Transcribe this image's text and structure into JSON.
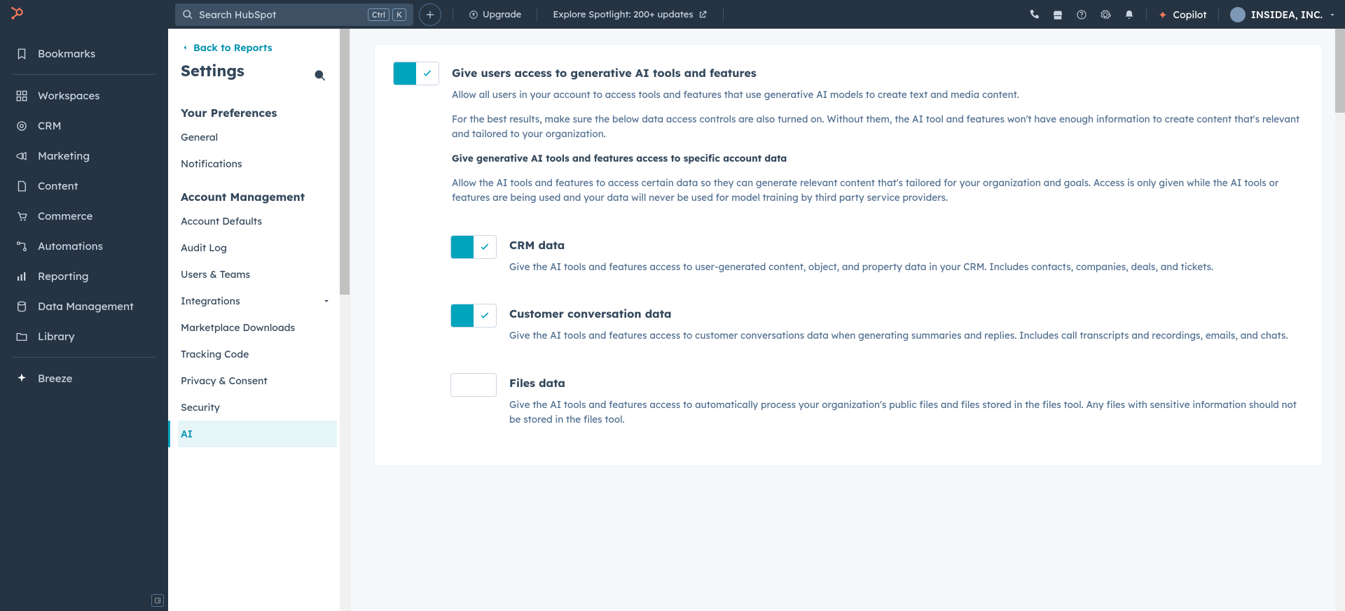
{
  "topbar": {
    "search_placeholder": "Search HubSpot",
    "kbd": [
      "Ctrl",
      "K"
    ],
    "upgrade": "Upgrade",
    "spotlight": "Explore Spotlight: 200+ updates",
    "copilot": "Copilot",
    "account_name": "INSIDEA, INC."
  },
  "primary_nav": {
    "items": [
      "Bookmarks",
      "Workspaces",
      "CRM",
      "Marketing",
      "Content",
      "Commerce",
      "Automations",
      "Reporting",
      "Data Management",
      "Library",
      "Breeze"
    ]
  },
  "settings": {
    "back": "Back to Reports",
    "title": "Settings",
    "group1": "Your Preferences",
    "items1": [
      "General",
      "Notifications"
    ],
    "group2": "Account Management",
    "items2": [
      "Account Defaults",
      "Audit Log",
      "Users & Teams",
      "Integrations",
      "Marketplace Downloads",
      "Tracking Code",
      "Privacy & Consent",
      "Security",
      "AI"
    ]
  },
  "main": {
    "main_toggle": {
      "on": true,
      "title": "Give users access to generative AI tools and features",
      "desc1": "Allow all users in your account to access tools and features that use generative AI models to create text and media content.",
      "desc2": "For the best results, make sure the below data access controls are also turned on. Without them, the AI tool and features won't have enough information to create content that's relevant and tailored to your organization.",
      "subhead": "Give generative AI tools and features access to specific account data",
      "desc3": "Allow the AI tools and features to access certain data so they can generate relevant content that's tailored for your organization and goals. Access is only given while the AI tools or features are being used and your data will never be used for model training by third party service providers."
    },
    "sub_toggles": [
      {
        "on": true,
        "title": "CRM data",
        "desc": "Give the AI tools and features access to user-generated content, object, and property data in your CRM. Includes contacts, companies, deals, and tickets."
      },
      {
        "on": true,
        "title": "Customer conversation data",
        "desc": "Give the AI tools and features access to customer conversations data when generating summaries and replies. Includes call transcripts and recordings, emails, and chats."
      },
      {
        "on": false,
        "title": "Files data",
        "desc": "Give the AI tools and features access to automatically process your organization's public files and files stored in the files tool. Any files with sensitive information should not be stored in the files tool."
      }
    ]
  }
}
